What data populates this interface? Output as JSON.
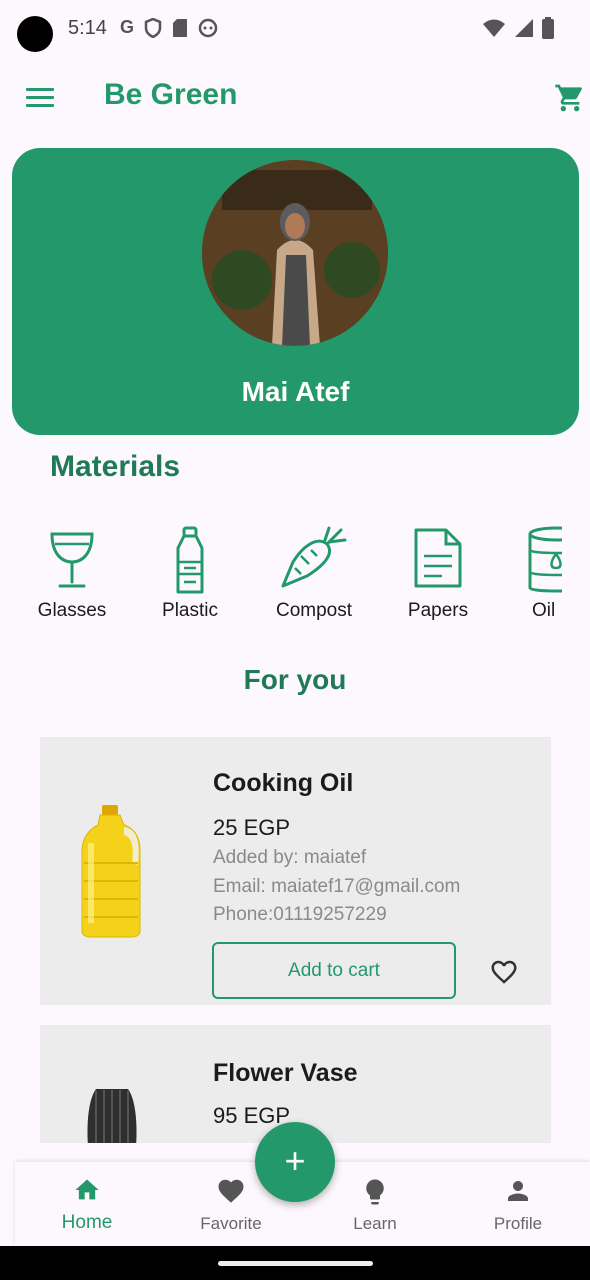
{
  "status_bar": {
    "time": "5:14"
  },
  "app_bar": {
    "title": "Be Green"
  },
  "profile": {
    "name": "Mai Atef"
  },
  "materials": {
    "title": "Materials",
    "items": [
      {
        "label": "Glasses",
        "icon": "wine-glass-icon"
      },
      {
        "label": "Plastic",
        "icon": "bottle-icon"
      },
      {
        "label": "Compost",
        "icon": "carrot-icon"
      },
      {
        "label": "Papers",
        "icon": "document-icon"
      },
      {
        "label": "Oil",
        "icon": "oil-barrel-icon"
      }
    ]
  },
  "for_you": {
    "title": "For you",
    "products": [
      {
        "name": "Cooking Oil",
        "price": "25 EGP",
        "added_by": "Added by: maiatef",
        "email": "Email: maiatef17@gmail.com",
        "phone": "Phone:01119257229",
        "add_to_cart": "Add to cart"
      },
      {
        "name": "Flower Vase",
        "price": "95 EGP"
      }
    ]
  },
  "fab": {
    "label": "+"
  },
  "bottom_nav": {
    "items": [
      {
        "label": "Home",
        "icon": "home-icon",
        "active": true
      },
      {
        "label": "Favorite",
        "icon": "heart-icon",
        "active": false
      },
      {
        "label": "Learn",
        "icon": "lightbulb-icon",
        "active": false
      },
      {
        "label": "Profile",
        "icon": "person-icon",
        "active": false
      }
    ]
  },
  "colors": {
    "primary": "#23996b",
    "card": "#ececec",
    "background": "#fdf8fd"
  }
}
